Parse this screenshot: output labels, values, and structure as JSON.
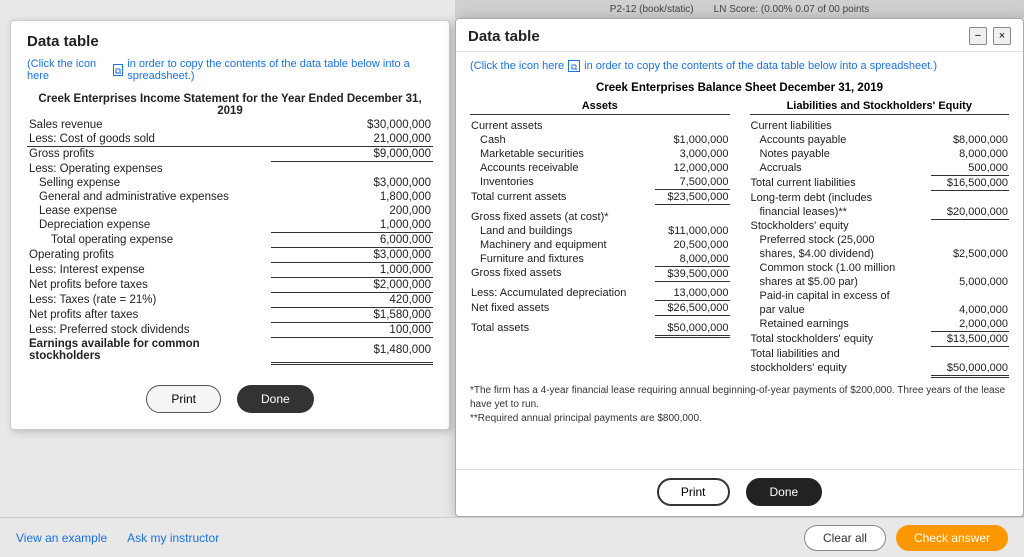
{
  "topbar": {
    "hint1": "P2-12 (book/static)",
    "hint2": "LN Score: (0.00% 0.07 of 00 points"
  },
  "bg_panel": {
    "title": "Data table",
    "copy_notice": "(Click the icon here",
    "copy_notice2": "in order to copy the contents of the data table below into a spreadsheet.)",
    "income_title": "Creek Enterprises Income Statement for the Year Ended December 31, 2019",
    "rows": [
      {
        "label": "Sales revenue",
        "value": "$30,000,000",
        "indent": 0,
        "bold": false
      },
      {
        "label": "Less: Cost of goods sold",
        "value": "21,000,000",
        "indent": 0,
        "bold": false
      },
      {
        "label": "Gross profits",
        "value": "$9,000,000",
        "indent": 0,
        "bold": false
      },
      {
        "label": "Less: Operating expenses",
        "value": "",
        "indent": 0,
        "bold": false
      },
      {
        "label": "Selling expense",
        "value": "$3,000,000",
        "indent": 1,
        "bold": false
      },
      {
        "label": "General and administrative expenses",
        "value": "1,800,000",
        "indent": 1,
        "bold": false
      },
      {
        "label": "Lease expense",
        "value": "200,000",
        "indent": 1,
        "bold": false
      },
      {
        "label": "Depreciation expense",
        "value": "1,000,000",
        "indent": 1,
        "bold": false
      },
      {
        "label": "Total operating expense",
        "value": "6,000,000",
        "indent": 2,
        "bold": false
      },
      {
        "label": "Operating profits",
        "value": "$3,000,000",
        "indent": 0,
        "bold": false
      },
      {
        "label": "Less: Interest expense",
        "value": "1,000,000",
        "indent": 0,
        "bold": false
      },
      {
        "label": "Net profits before taxes",
        "value": "$2,000,000",
        "indent": 0,
        "bold": false
      },
      {
        "label": "Less: Taxes (rate = 21%)",
        "value": "420,000",
        "indent": 0,
        "bold": false
      },
      {
        "label": "Net profits after taxes",
        "value": "$1,580,000",
        "indent": 0,
        "bold": false
      },
      {
        "label": "Less: Preferred stock dividends",
        "value": "100,000",
        "indent": 0,
        "bold": false
      },
      {
        "label": "Earnings available for common stockholders",
        "value": "$1,480,000",
        "indent": 0,
        "bold": true
      }
    ],
    "print_label": "Print",
    "done_label": "Done"
  },
  "modal": {
    "title": "Data table",
    "copy_notice": "(Click the icon here",
    "copy_notice2": "in order to copy the contents of the data table below into a spreadsheet.)",
    "balance_title": "Creek Enterprises Balance Sheet December 31, 2019",
    "assets_header": "Assets",
    "liabilities_header": "Liabilities and Stockholders' Equity",
    "assets": [
      {
        "label": "Current assets",
        "value": "",
        "indent": 0,
        "bold": false
      },
      {
        "label": "Cash",
        "value": "$1,000,000",
        "indent": 1,
        "bold": false
      },
      {
        "label": "Marketable securities",
        "value": "3,000,000",
        "indent": 1,
        "bold": false
      },
      {
        "label": "Accounts receivable",
        "value": "12,000,000",
        "indent": 1,
        "bold": false
      },
      {
        "label": "Inventories",
        "value": "7,500,000",
        "indent": 1,
        "bold": false
      },
      {
        "label": "Total current assets",
        "value": "$23,500,000",
        "indent": 0,
        "bold": false
      },
      {
        "label": "",
        "value": "",
        "indent": 0,
        "bold": false
      },
      {
        "label": "Gross fixed assets (at cost)*",
        "value": "",
        "indent": 0,
        "bold": false
      },
      {
        "label": "Land and buildings",
        "value": "$11,000,000",
        "indent": 1,
        "bold": false
      },
      {
        "label": "Machinery and equipment",
        "value": "20,500,000",
        "indent": 1,
        "bold": false
      },
      {
        "label": "Furniture and fixtures",
        "value": "8,000,000",
        "indent": 1,
        "bold": false
      },
      {
        "label": "Gross fixed assets",
        "value": "$39,500,000",
        "indent": 0,
        "bold": false
      },
      {
        "label": "",
        "value": "",
        "indent": 0,
        "bold": false
      },
      {
        "label": "Less: Accumulated depreciation",
        "value": "13,000,000",
        "indent": 0,
        "bold": false
      },
      {
        "label": "Net fixed assets",
        "value": "$26,500,000",
        "indent": 0,
        "bold": false
      },
      {
        "label": "",
        "value": "",
        "indent": 0,
        "bold": false
      },
      {
        "label": "Total assets",
        "value": "$50,000,000",
        "indent": 0,
        "bold": false
      }
    ],
    "liabilities": [
      {
        "label": "Current liabilities",
        "value": "",
        "indent": 0,
        "bold": false
      },
      {
        "label": "Accounts payable",
        "value": "$8,000,000",
        "indent": 1,
        "bold": false
      },
      {
        "label": "Notes payable",
        "value": "8,000,000",
        "indent": 1,
        "bold": false
      },
      {
        "label": "Accruals",
        "value": "500,000",
        "indent": 1,
        "bold": false
      },
      {
        "label": "Total current liabilities",
        "value": "$16,500,000",
        "indent": 0,
        "bold": false
      },
      {
        "label": "Long-term debt (includes",
        "value": "",
        "indent": 0,
        "bold": false
      },
      {
        "label": "financial leases)**",
        "value": "$20,000,000",
        "indent": 1,
        "bold": false
      },
      {
        "label": "Stockholders' equity",
        "value": "",
        "indent": 0,
        "bold": false
      },
      {
        "label": "Preferred stock (25,000",
        "value": "",
        "indent": 1,
        "bold": false
      },
      {
        "label": "shares, $4.00 dividend)",
        "value": "$2,500,000",
        "indent": 1,
        "bold": false
      },
      {
        "label": "Common stock (1.00 million",
        "value": "",
        "indent": 1,
        "bold": false
      },
      {
        "label": "shares at $5.00 par)",
        "value": "5,000,000",
        "indent": 1,
        "bold": false
      },
      {
        "label": "Paid-in capital in excess of",
        "value": "",
        "indent": 1,
        "bold": false
      },
      {
        "label": "par value",
        "value": "4,000,000",
        "indent": 1,
        "bold": false
      },
      {
        "label": "Retained earnings",
        "value": "2,000,000",
        "indent": 1,
        "bold": false
      },
      {
        "label": "Total stockholders' equity",
        "value": "$13,500,000",
        "indent": 0,
        "bold": false
      },
      {
        "label": "Total liabilities and",
        "value": "",
        "indent": 0,
        "bold": false
      },
      {
        "label": "stockholders' equity",
        "value": "$50,000,000",
        "indent": 0,
        "bold": false
      }
    ],
    "footnotes": [
      "*The firm has a 4-year financial lease requiring annual beginning-of-year payments of $200,000. Three years of the lease have yet to run.",
      "**Required annual principal payments are $800,000."
    ],
    "print_label": "Print",
    "done_label": "Done"
  },
  "bottom": {
    "view_example": "View an example",
    "ask_instructor": "Ask my instructor",
    "clear_all": "Clear all",
    "check_answer": "Check answer"
  }
}
